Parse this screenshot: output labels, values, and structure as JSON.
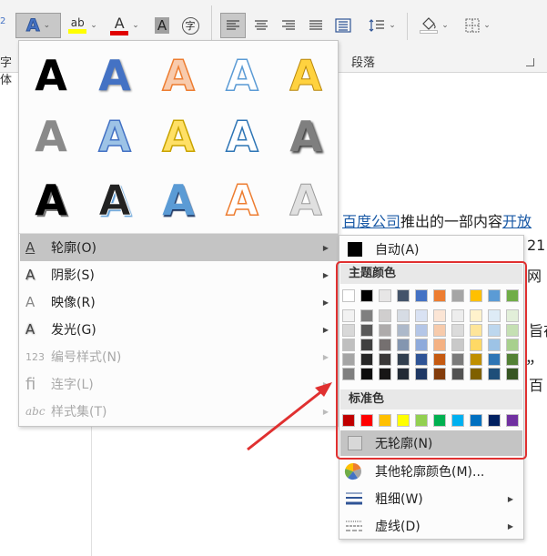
{
  "ribbon": {
    "font_group_label": "字体",
    "font_group_partial": "字体",
    "para_group_label": "段落",
    "text_effect_glyph": "A",
    "highlight_glyph": "ab",
    "font_color_glyph": "A",
    "char_shading_glyph": "A",
    "enclose_glyph": "字",
    "superscript_glyph": "2"
  },
  "document": {
    "line1_link1": "百度公司",
    "line1_text": "推出的一部内容",
    "line1_link2": "开放",
    "frag_21": "21",
    "frag_wang": "网​",
    "frag_zhi": "旨在",
    "frag_comma1": "，",
    "frag_comma2": "，",
    "frag_bai": "百",
    "return_mark": "↵"
  },
  "left_menu": {
    "text_art_letter": "A",
    "items": [
      {
        "label": "轮廓(O)",
        "icon": "A"
      },
      {
        "label": "阴影(S)",
        "icon": "A"
      },
      {
        "label": "映像(R)",
        "icon": "A"
      },
      {
        "label": "发光(G)",
        "icon": "A"
      },
      {
        "label": "编号样式(N)",
        "icon": "123"
      },
      {
        "label": "连字(L)",
        "icon": "fi"
      },
      {
        "label": "样式集(T)",
        "icon": "abc"
      }
    ]
  },
  "right_menu": {
    "auto_label": "自动(A)",
    "theme_colors_header": "主题颜色",
    "standard_colors_header": "标准色",
    "no_outline_label": "无轮廓(N)",
    "more_colors_label": "其他轮廓颜色(M)...",
    "weight_label": "粗细(W)",
    "dashes_label": "虚线(D)",
    "theme_top_row": [
      "#ffffff",
      "#000000",
      "#e7e6e6",
      "#44546a",
      "#4472c4",
      "#ed7d31",
      "#a5a5a5",
      "#ffc000",
      "#5b9bd5",
      "#70ad47"
    ],
    "theme_shades": [
      [
        "#f2f2f2",
        "#7f7f7f",
        "#d0cece",
        "#d6dce4",
        "#d9e2f3",
        "#fbe5d5",
        "#ededed",
        "#fff2cc",
        "#deebf6",
        "#e2efd9"
      ],
      [
        "#d8d8d8",
        "#595959",
        "#aeabab",
        "#adb9ca",
        "#b4c6e7",
        "#f7cbac",
        "#dbdbdb",
        "#fee599",
        "#bdd7ee",
        "#c5e0b3"
      ],
      [
        "#bfbfbf",
        "#3f3f3f",
        "#757070",
        "#8496b0",
        "#8eaadb",
        "#f4b183",
        "#c9c9c9",
        "#ffd965",
        "#9dc3e6",
        "#a8d08d"
      ],
      [
        "#a5a5a5",
        "#262626",
        "#3a3838",
        "#323f4f",
        "#2f5496",
        "#c55a11",
        "#7b7b7b",
        "#bf8f00",
        "#2e75b5",
        "#538135"
      ],
      [
        "#7f7f7f",
        "#0c0c0c",
        "#171616",
        "#222a35",
        "#1f3864",
        "#833c0b",
        "#525252",
        "#7f6000",
        "#1e4e79",
        "#375623"
      ]
    ],
    "standard_row": [
      "#c00000",
      "#ff0000",
      "#ffc000",
      "#ffff00",
      "#92d050",
      "#00b050",
      "#00b0f0",
      "#0070c0",
      "#002060",
      "#7030a0"
    ]
  }
}
